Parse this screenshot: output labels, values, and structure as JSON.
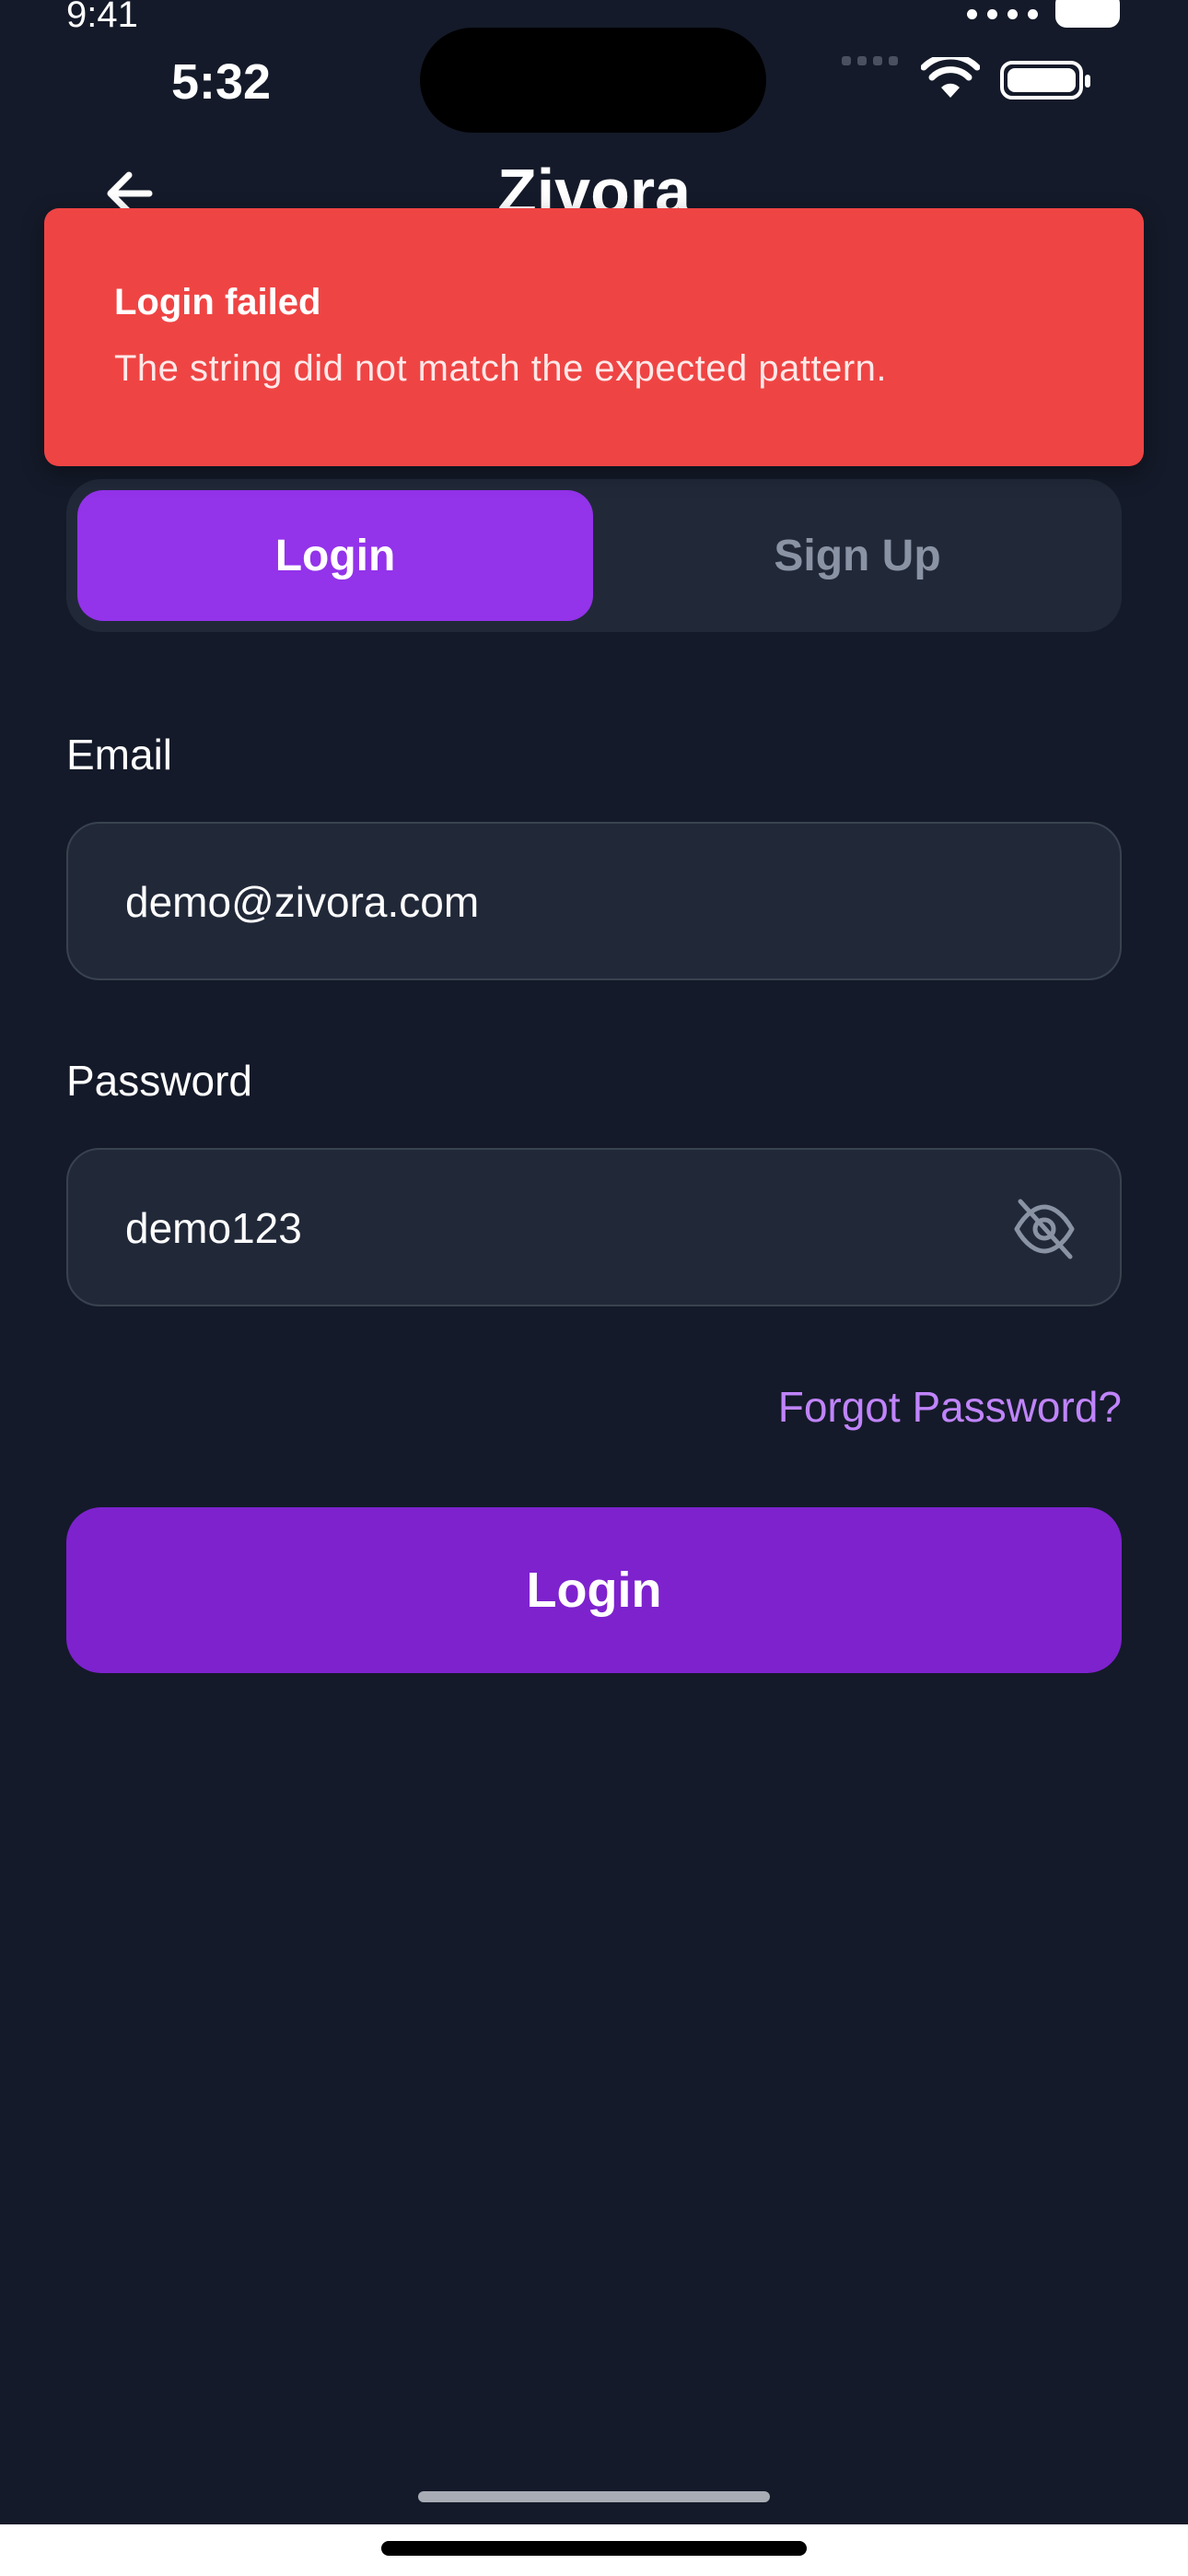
{
  "outer_status": {
    "time": "9:41"
  },
  "status_bar": {
    "time": "5:32"
  },
  "header": {
    "title": "Zivora"
  },
  "toast": {
    "title": "Login failed",
    "message": "The string did not match the expected pattern."
  },
  "tabs": {
    "login_label": "Login",
    "signup_label": "Sign Up",
    "selected": "Login"
  },
  "form": {
    "email_label": "Email",
    "email_value": "demo@zivora.com",
    "password_label": "Password",
    "password_value": "demo123",
    "forgot_label": "Forgot Password?",
    "submit_label": "Login"
  },
  "colors": {
    "background": "#141a29",
    "accent": "#9333ea",
    "button": "#7e22ce",
    "error": "#ef4444",
    "link": "#c084fc"
  },
  "icons": {
    "back": "arrow-left-icon",
    "password_toggle": "eye-off-icon",
    "wifi": "wifi-icon",
    "battery": "battery-icon"
  }
}
